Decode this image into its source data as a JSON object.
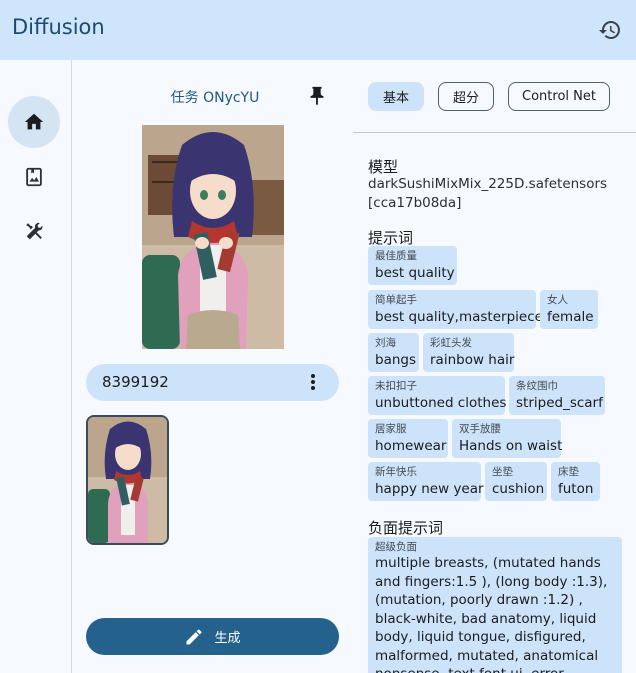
{
  "app": {
    "title": "Diffusion"
  },
  "rail": {
    "items": [
      "home",
      "gallery",
      "tools"
    ]
  },
  "task": {
    "title": "任务 ONycYU"
  },
  "seed": {
    "value": "8399192"
  },
  "generate": {
    "label": "生成"
  },
  "tabs": [
    {
      "label": "基本",
      "active": true
    },
    {
      "label": "超分",
      "active": false
    },
    {
      "label": "Control Net",
      "active": false
    }
  ],
  "model": {
    "heading": "模型",
    "name": "darkSushiMixMix_225D.safetensors",
    "hash": "[cca17b08da]"
  },
  "prompt": {
    "heading": "提示词",
    "tags": [
      {
        "zh": "最佳质量",
        "en": "best quality"
      },
      {
        "zh": "简单起手",
        "en": "best quality,masterpiece"
      },
      {
        "zh": "女人",
        "en": "female"
      },
      {
        "zh": "刘海",
        "en": "bangs"
      },
      {
        "zh": "彩虹头发",
        "en": "rainbow hair"
      },
      {
        "zh": "未扣扣子",
        "en": "unbuttoned clothes"
      },
      {
        "zh": "条纹围巾",
        "en": "striped_scarf"
      },
      {
        "zh": "居家服",
        "en": "homewear"
      },
      {
        "zh": "双手放腰",
        "en": "Hands on waist"
      },
      {
        "zh": "新年快乐",
        "en": "happy new year"
      },
      {
        "zh": "坐垫",
        "en": "cushion"
      },
      {
        "zh": "床垫",
        "en": "futon"
      }
    ]
  },
  "negative": {
    "heading": "负面提示词",
    "zh": "超级负面",
    "en": "multiple breasts, (mutated hands and fingers:1.5 ), (long body :1.3), (mutation, poorly drawn :1.2) , black-white, bad anatomy, liquid body, liquid tongue, disfigured, malformed, mutated, anatomical nonsense, text font ui, error"
  }
}
